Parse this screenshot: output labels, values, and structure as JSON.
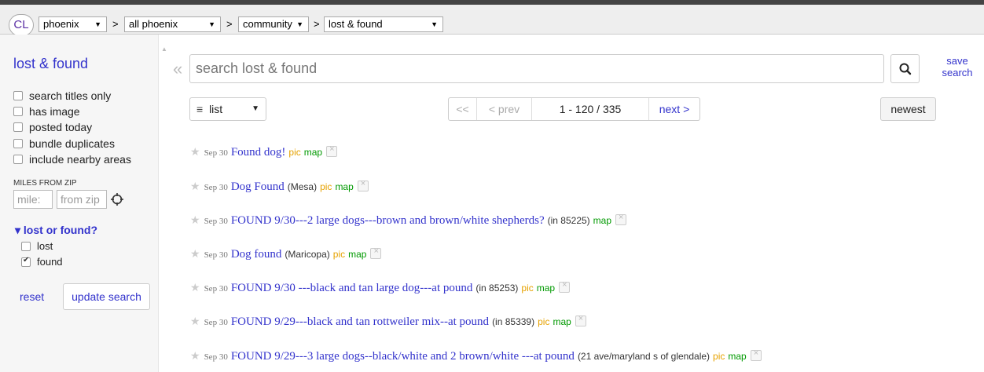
{
  "topbar": {
    "logo": "CL",
    "breadcrumbs": [
      {
        "label": "phoenix",
        "arrow": "▼"
      },
      {
        "label": "all phoenix",
        "arrow": "▼"
      },
      {
        "label": "community",
        "arrow": "▼"
      },
      {
        "label": "lost & found",
        "arrow": "▼"
      }
    ],
    "separator": ">"
  },
  "sidebar": {
    "title": "lost & found",
    "options": [
      "search titles only",
      "has image",
      "posted today",
      "bundle duplicates",
      "include nearby areas"
    ],
    "miles_label": "MILES FROM ZIP",
    "miles_placeholder": "mile:",
    "zip_placeholder": "from zip",
    "filter_title": "▾ lost or found?",
    "filter_options": [
      {
        "label": "lost",
        "checked": false
      },
      {
        "label": "found",
        "checked": true
      }
    ],
    "reset_label": "reset",
    "update_label": "update search"
  },
  "search": {
    "collapse_glyph": "«",
    "placeholder": "search lost & found",
    "save_label": "save search"
  },
  "toolbar": {
    "view_label": "list",
    "view_arrow": "▼",
    "first": "<<",
    "prev": "< prev",
    "range": "1 - 120 / 335",
    "next": "next >",
    "sort_label": "newest"
  },
  "listings": [
    {
      "date": "Sep 30",
      "title": "Found dog!",
      "hood": "",
      "pic": "pic",
      "map": "map"
    },
    {
      "date": "Sep 30",
      "title": "Dog Found",
      "hood": "(Mesa)",
      "pic": "pic",
      "map": "map"
    },
    {
      "date": "Sep 30",
      "title": "FOUND 9/30---2 large dogs---brown and brown/white shepherds?",
      "hood": "(in 85225)",
      "pic": "",
      "map": "map"
    },
    {
      "date": "Sep 30",
      "title": "Dog found",
      "hood": "(Maricopa)",
      "pic": "pic",
      "map": "map"
    },
    {
      "date": "Sep 30",
      "title": "FOUND 9/30 ---black and tan large dog---at pound",
      "hood": "(in 85253)",
      "pic": "pic",
      "map": "map"
    },
    {
      "date": "Sep 30",
      "title": "FOUND 9/29---black and tan rottweiler mix--at pound",
      "hood": "(in 85339)",
      "pic": "pic",
      "map": "map"
    },
    {
      "date": "Sep 30",
      "title": "FOUND 9/29---3 large dogs--black/white and 2 brown/white ---at pound",
      "hood": "(21 ave/maryland s of glendale)",
      "pic": "pic",
      "map": "map"
    }
  ],
  "colors": {
    "link": "#3333cc",
    "pic": "#e6a200",
    "map": "#009900"
  }
}
